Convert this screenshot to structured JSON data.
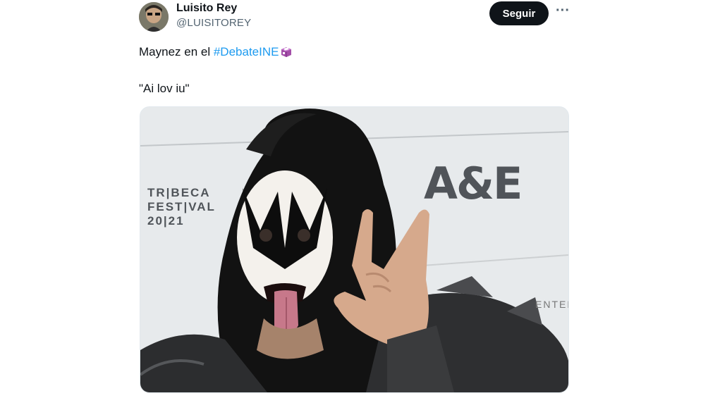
{
  "tweet": {
    "author_name": "Luisito Rey",
    "author_handle": "@LUISITOREY",
    "follow_label": "Seguir",
    "more_label": "···",
    "text_prefix": "Maynez en el ",
    "hashtag": "#DebateINE",
    "quote": "\"Ai lov iu\""
  },
  "image": {
    "tribeca_lines": [
      "TR|BECA",
      "FEST|VAL",
      "20|21"
    ],
    "sponsor_logo": "A&E",
    "partial_sign": "ENTED"
  },
  "icons": {
    "more": "more-dots-icon",
    "ballot": "ballot-box-emoji-icon"
  },
  "colors": {
    "link": "#1d9bf0",
    "button": "#0f1419",
    "secondary_text": "#536471"
  }
}
